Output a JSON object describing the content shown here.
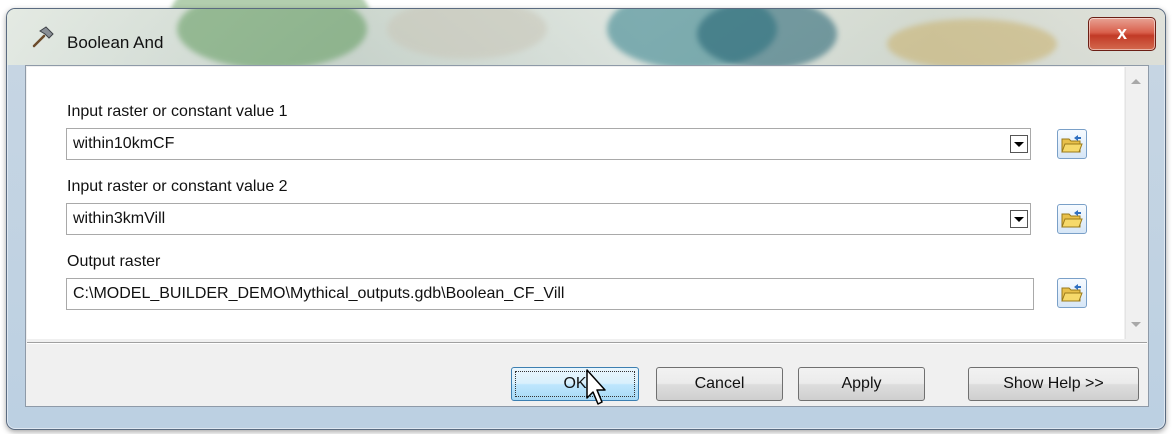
{
  "window": {
    "title": "Boolean And",
    "close_label": "x"
  },
  "params": [
    {
      "label": "Input raster or constant value 1",
      "value": "within10kmCF",
      "type": "combo"
    },
    {
      "label": "Input raster or constant value 2",
      "value": "within3kmVill",
      "type": "combo"
    },
    {
      "label": "Output raster",
      "value": "C:\\MODEL_BUILDER_DEMO\\Mythical_outputs.gdb\\Boolean_CF_Vill",
      "type": "text"
    }
  ],
  "buttons": {
    "ok": "OK",
    "cancel": "Cancel",
    "apply": "Apply",
    "show_help": "Show Help >>"
  },
  "icons": {
    "title": "hammer-icon",
    "browse": "open-folder-icon",
    "close": "close-icon",
    "cursor": "mouse-pointer-icon"
  },
  "colors": {
    "close_button": "#c23a26",
    "ok_button": "#bee6fd",
    "frame": "#bcd0e2"
  }
}
